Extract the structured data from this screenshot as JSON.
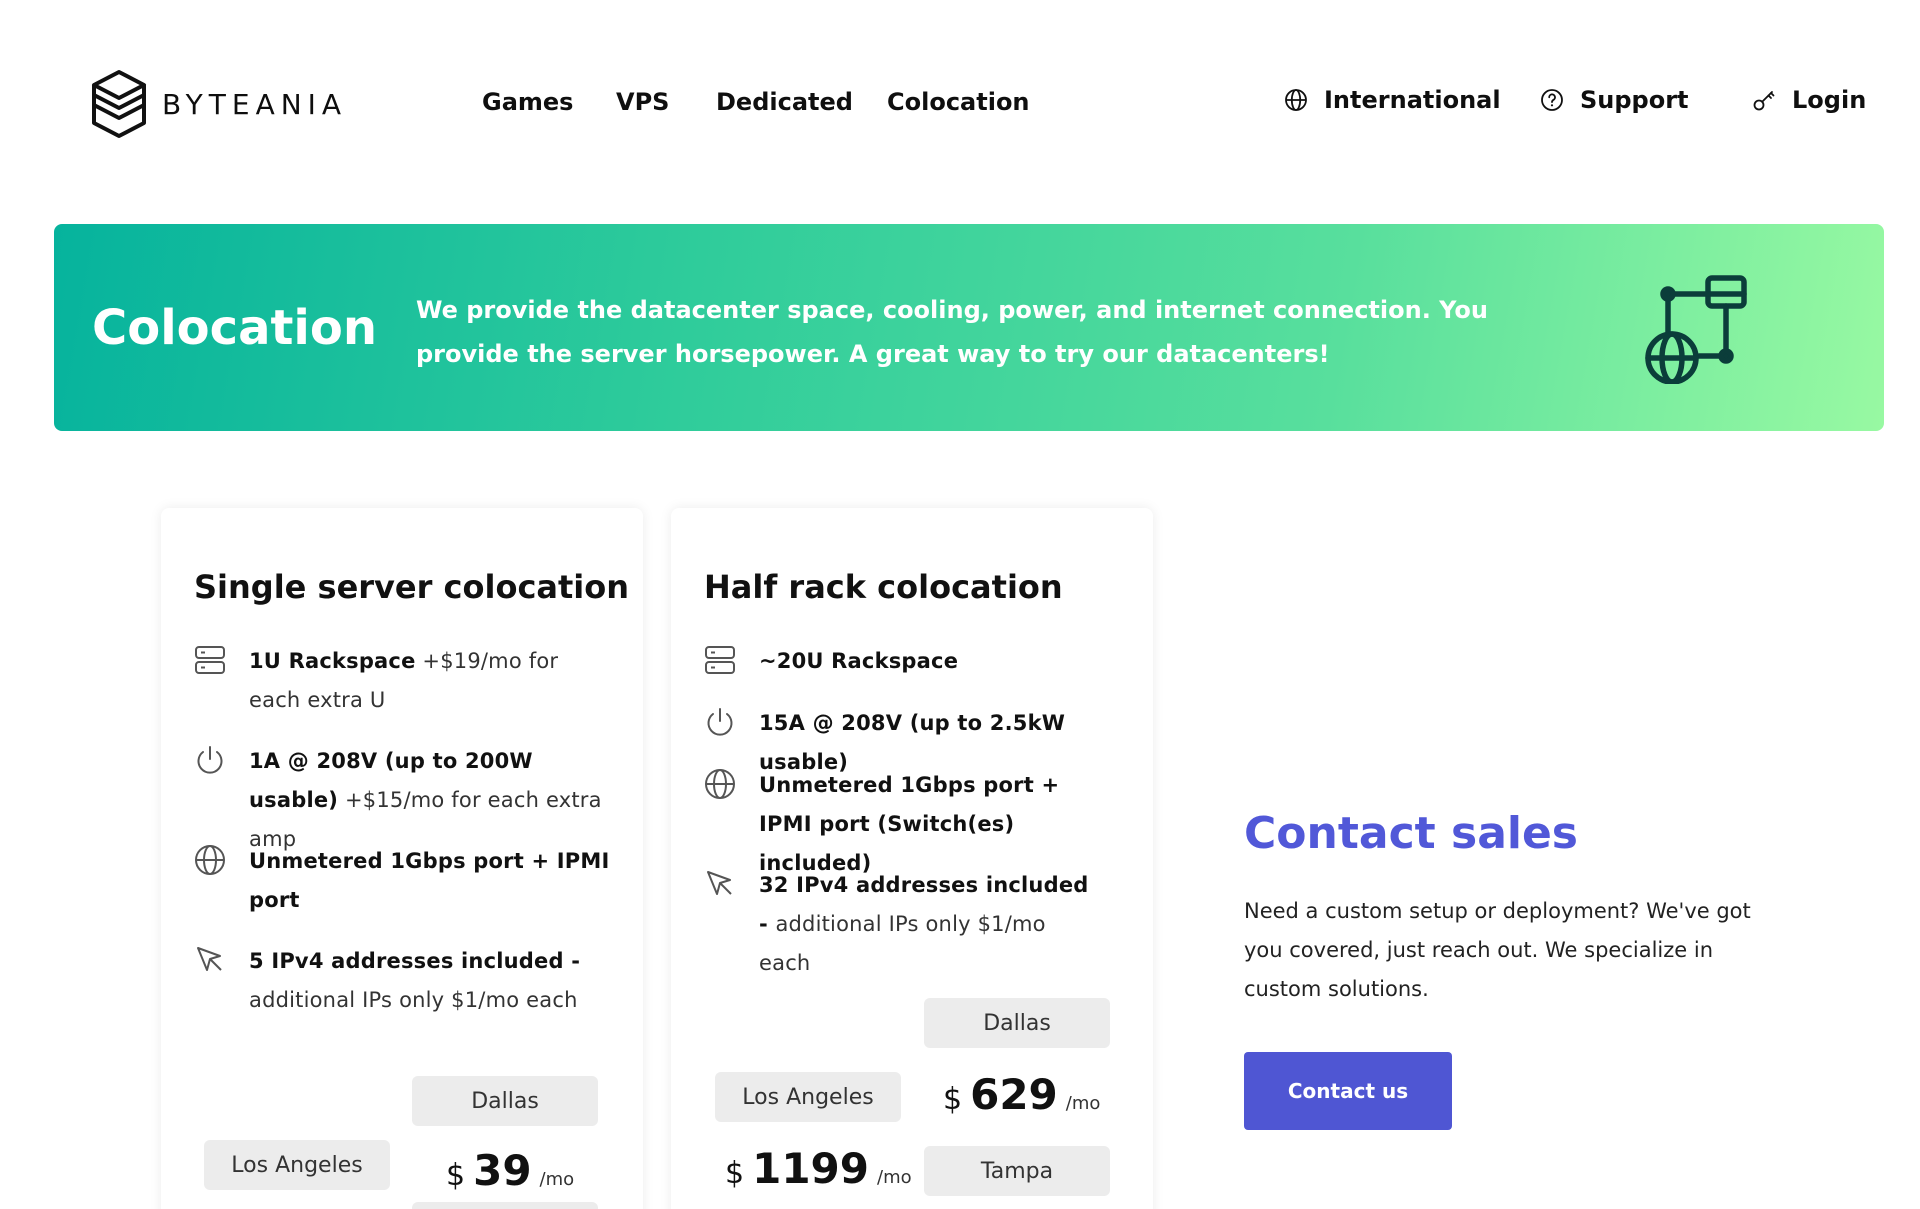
{
  "brand": {
    "name": "BYTEANIA"
  },
  "nav": [
    {
      "label": "Games"
    },
    {
      "label": "VPS"
    },
    {
      "label": "Dedicated"
    },
    {
      "label": "Colocation"
    }
  ],
  "utility": {
    "international": "International",
    "support": "Support",
    "login": "Login"
  },
  "hero": {
    "title": "Colocation",
    "description": "We provide the datacenter space, cooling, power, and internet connection. You provide the server horsepower. A great way to try our datacenters!",
    "icon": "network-globe-icon"
  },
  "plans": [
    {
      "title": "Single server colocation",
      "features": [
        {
          "icon": "server-icon",
          "strong": "1U Rackspace",
          "extra": " +$19/mo for each extra U"
        },
        {
          "icon": "power-icon",
          "strong": "1A @ 208V (up to 200W usable)",
          "extra": " +$15/mo for each extra amp"
        },
        {
          "icon": "globe-icon",
          "strong": "Unmetered 1Gbps port + IPMI port",
          "extra": ""
        },
        {
          "icon": "cursor-icon",
          "strong": "5 IPv4 addresses included - ",
          "extra": "additional IPs only $1/mo each"
        }
      ],
      "locations": {
        "dallas": "Dallas",
        "los_angeles": "Los Angeles"
      },
      "price": {
        "currency": "$",
        "amount": "39",
        "period": "/mo"
      }
    },
    {
      "title": "Half rack colocation",
      "features": [
        {
          "icon": "server-icon",
          "strong": "~20U Rackspace",
          "extra": ""
        },
        {
          "icon": "power-icon",
          "strong": "15A @ 208V (up to 2.5kW usable)",
          "extra": ""
        },
        {
          "icon": "globe-icon",
          "strong": "Unmetered 1Gbps port + IPMI port (Switch(es) included)",
          "extra": ""
        },
        {
          "icon": "cursor-icon",
          "strong": "32 IPv4 addresses included - ",
          "extra": "additional IPs only $1/mo each"
        }
      ],
      "locations": {
        "dallas": "Dallas",
        "los_angeles": "Los Angeles",
        "tampa": "Tampa"
      },
      "prices": {
        "dallas": {
          "currency": "$",
          "amount": "629",
          "period": "/mo"
        },
        "los_angeles": {
          "currency": "$",
          "amount": "1199",
          "period": "/mo"
        }
      }
    }
  ],
  "contact": {
    "title": "Contact sales",
    "description": "Need a custom setup or deployment? We've got you covered, just reach out. We specialize in custom solutions.",
    "button": "Contact us"
  },
  "colors": {
    "accent": "#4f56d3",
    "hero_start": "#06b39d",
    "hero_end": "#98f9a2",
    "icon_dark": "#0b3d3a"
  }
}
